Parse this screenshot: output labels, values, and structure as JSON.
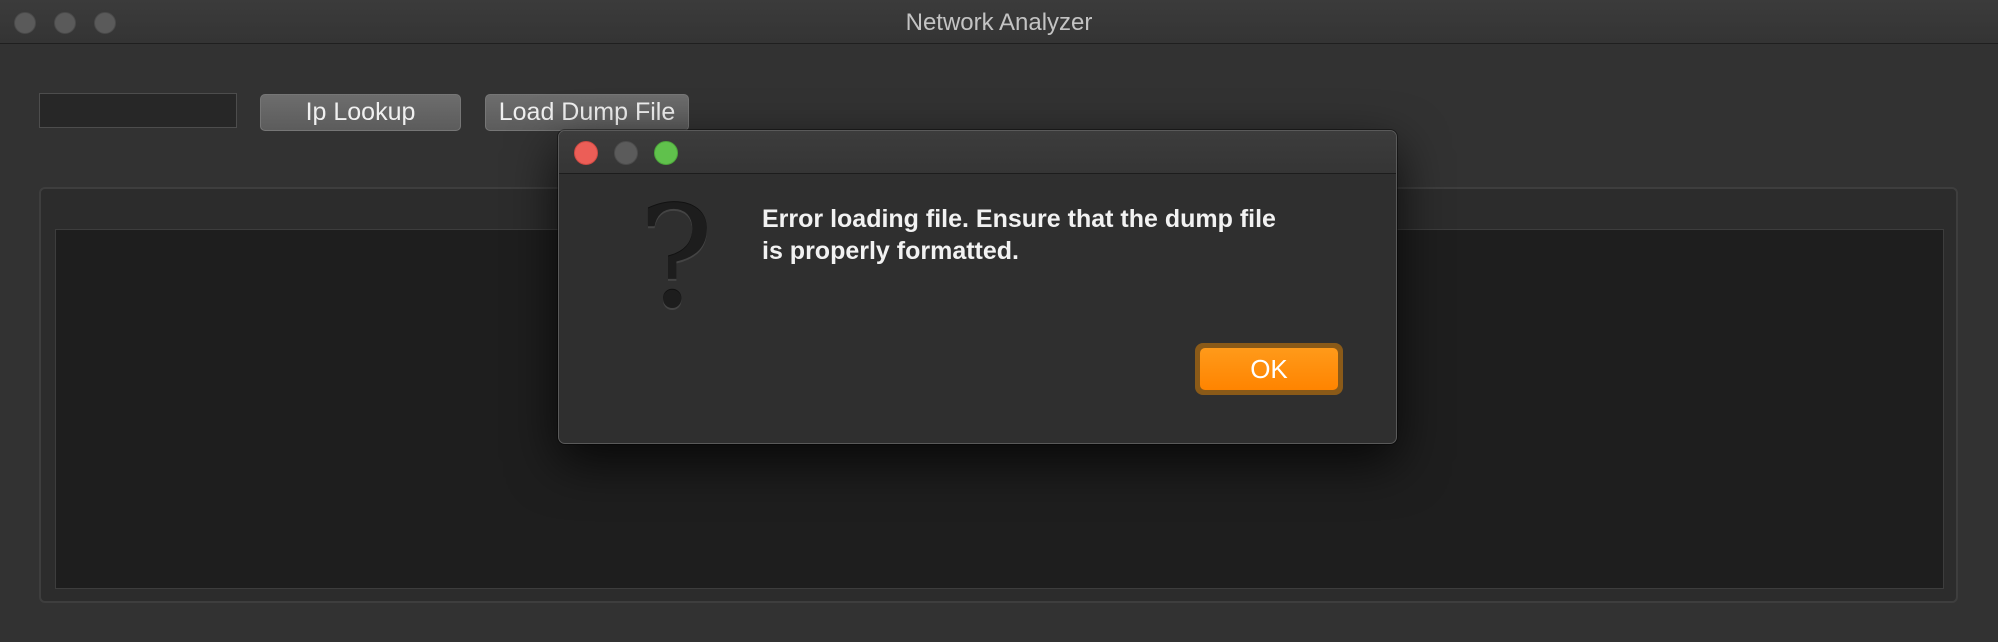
{
  "window": {
    "title": "Network Analyzer"
  },
  "toolbar": {
    "ip_field_value": "",
    "ip_lookup_label": "Ip Lookup",
    "load_dump_label": "Load Dump File"
  },
  "dialog": {
    "icon": "question-mark-icon",
    "message": "Error loading file.  Ensure that the dump file\nis properly formatted.",
    "ok_label": "OK",
    "accent_color": "#ff8c0a"
  }
}
